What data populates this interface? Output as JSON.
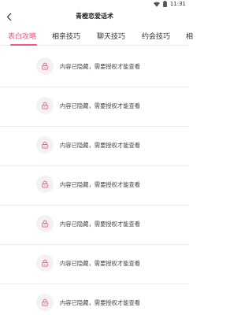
{
  "status_bar": {
    "time": "11:31",
    "icons": [
      "wifi-icon",
      "battery-icon"
    ]
  },
  "app_bar": {
    "title": "青橙恋爱话术",
    "back_icon": "back-arrow-icon"
  },
  "tabs": [
    {
      "label": "表白攻略",
      "active": true
    },
    {
      "label": "相亲技巧",
      "active": false
    },
    {
      "label": "聊天技巧",
      "active": false
    },
    {
      "label": "约会技巧",
      "active": false
    },
    {
      "label": "相",
      "active": false
    }
  ],
  "colors": {
    "accent": "#f05a8a",
    "divider": "#eeeeee",
    "lock_bg": "#f4f1f2"
  },
  "items": [
    {
      "text": "内容已隐藏，需要授权才能查看",
      "icon": "lock-icon"
    },
    {
      "text": "内容已隐藏，需要授权才能查看",
      "icon": "lock-icon"
    },
    {
      "text": "内容已隐藏，需要授权才能查看",
      "icon": "lock-icon"
    },
    {
      "text": "内容已隐藏，需要授权才能查看",
      "icon": "lock-icon"
    },
    {
      "text": "内容已隐藏，需要授权才能查看",
      "icon": "lock-icon"
    },
    {
      "text": "内容已隐藏，需要授权才能查看",
      "icon": "lock-icon"
    },
    {
      "text": "内容已隐藏，需要授权才能查看",
      "icon": "lock-icon"
    }
  ]
}
